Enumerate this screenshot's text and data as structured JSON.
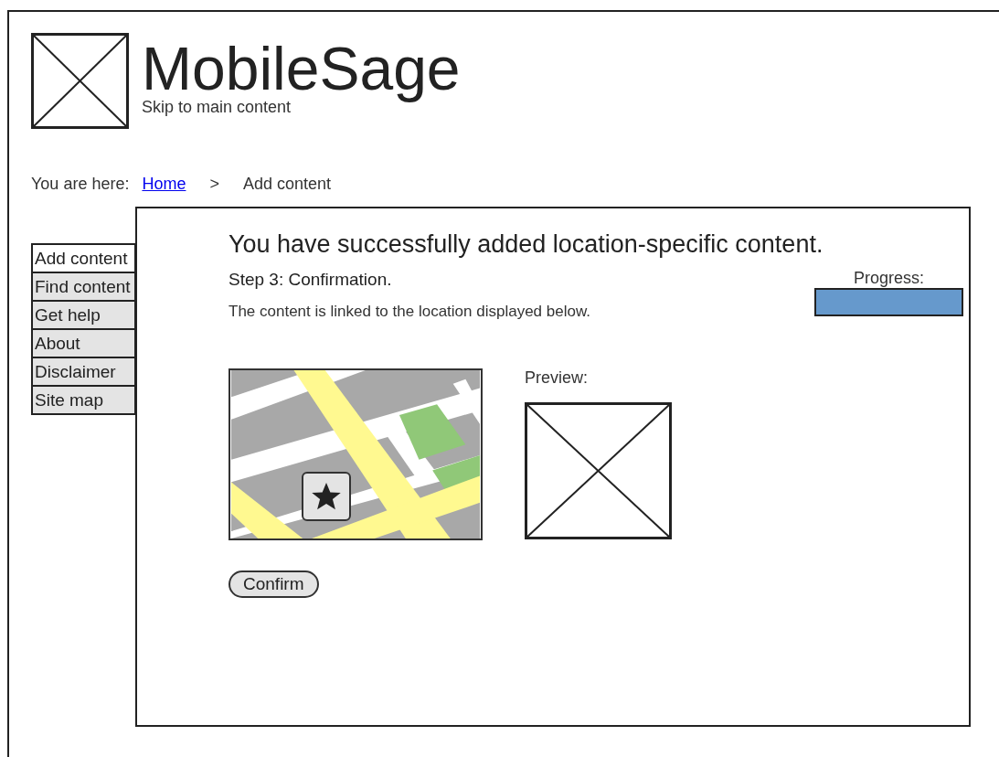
{
  "header": {
    "title": "MobileSage",
    "skip_link": "Skip to main content"
  },
  "breadcrumb": {
    "label": "You are here:",
    "items": [
      {
        "text": "Home",
        "kind": "link"
      },
      {
        "text": ">",
        "kind": "separator"
      },
      {
        "text": "Add content",
        "kind": "current"
      }
    ]
  },
  "nav": [
    {
      "label": "Add content",
      "selected": true
    },
    {
      "label": "Find content",
      "selected": false
    },
    {
      "label": "Get help",
      "selected": false
    },
    {
      "label": "About",
      "selected": false
    },
    {
      "label": "Disclaimer",
      "selected": false
    },
    {
      "label": "Site map",
      "selected": false
    }
  ],
  "content": {
    "heading": "You have successfully added location-specific content.",
    "step": "Step 3: Confirmation.",
    "description": "The content is linked to the location displayed below.",
    "progress": {
      "label": "Progress:",
      "level": 1
    },
    "preview_label": "Preview:",
    "confirm_button": "Confirm"
  }
}
